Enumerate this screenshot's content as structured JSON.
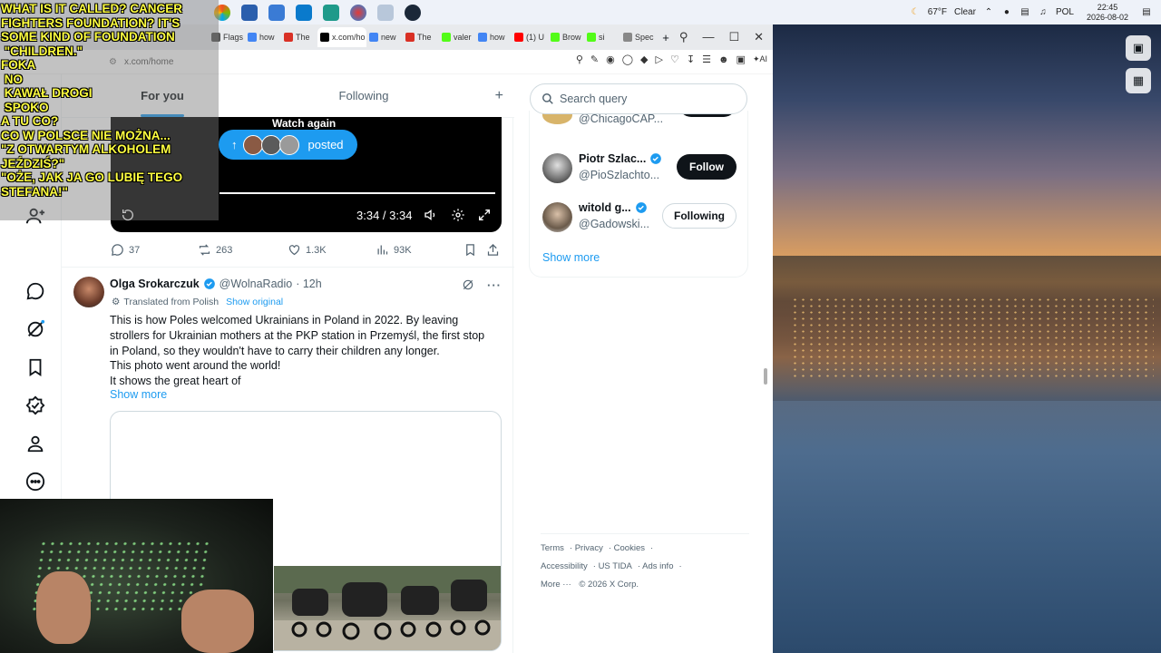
{
  "taskbar": {
    "weather_temp": "67°F",
    "weather_cond": "Clear",
    "language": "POL",
    "time": "22:45",
    "date": "2026-08-02"
  },
  "browser": {
    "tabs": [
      {
        "label": "Flags",
        "color": "#555"
      },
      {
        "label": "how",
        "color": "#4285f4"
      },
      {
        "label": "The",
        "color": "#d93025"
      },
      {
        "label": "x.com/ho",
        "color": "#000",
        "active": true
      },
      {
        "label": "new",
        "color": "#4285f4"
      },
      {
        "label": "The",
        "color": "#d93025"
      },
      {
        "label": "valer",
        "color": "#53fc18"
      },
      {
        "label": "how",
        "color": "#4285f4"
      },
      {
        "label": "(1) U",
        "color": "#ff0000"
      },
      {
        "label": "Brow",
        "color": "#53fc18"
      },
      {
        "label": "si",
        "color": "#53fc18"
      },
      {
        "label": "Spec",
        "color": "#888"
      }
    ],
    "url": "x.com/home",
    "ai_label": "AI"
  },
  "timeline": {
    "tab_for_you": "For you",
    "tab_following": "Following",
    "watch_again": "Watch again",
    "posted_label": "posted",
    "video_time": "3:34 / 3:34",
    "replies": "37",
    "reposts": "263",
    "likes": "1.3K",
    "views": "93K"
  },
  "post": {
    "author": "Olga Srokarczuk",
    "handle": "@WolnaRadio",
    "time": "· 12h",
    "translated_label": "Translated from Polish",
    "show_original": "Show original",
    "text_lines": [
      "This is how Poles welcomed Ukrainians in Poland in 2022. By leaving",
      "strollers for Ukrainian mothers at the PKP station in Przemyśl, the first stop",
      "in Poland, so they wouldn't have to carry their children any longer.",
      "This photo went around the world!",
      "It shows the great heart of"
    ],
    "show_more": "Show more"
  },
  "right": {
    "search_placeholder": "Search query",
    "who_to_follow": [
      {
        "name": "",
        "handle": "@ChicagoCAP...",
        "button": ""
      },
      {
        "name": "Piotr Szlac...",
        "handle": "@PioSzlachto...",
        "button": "Follow"
      },
      {
        "name": "witold g...",
        "handle": "@Gadowski...",
        "button": "Following"
      }
    ],
    "show_more": "Show more",
    "footer": [
      "Terms",
      "Privacy",
      "Cookies",
      "Accessibility",
      "US TIDA",
      "Ads info",
      "More ···",
      "© 2026 X Corp."
    ]
  },
  "overlay": {
    "lines": [
      "WHAT IS IT CALLED? CANCER",
      "FIGHTERS FOUNDATION? IT'S",
      "SOME KIND OF FOUNDATION",
      " \"CHILDREN.\"",
      "FOKA",
      " NO",
      " KAWAŁ DROGI",
      " SPOKO",
      "A TU CO?",
      "CO W POLSCE NIE MOŻNA...",
      "\"Z OTWARTYM ALKOHOLEM",
      "JEŹDZIŚ?\"",
      "\"OŻE, JAK JA GO LUBIĘ TEGO",
      "STEFANA!\""
    ]
  },
  "colors": {
    "accent": "#1d9bf0",
    "overlay_text": "#ffff40"
  }
}
